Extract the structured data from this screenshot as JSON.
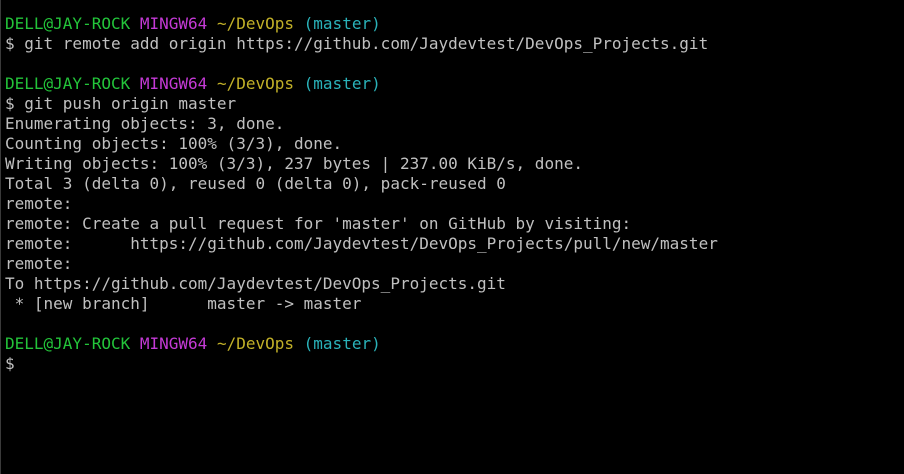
{
  "colors": {
    "background": "#000000",
    "foreground": "#c0c0c0",
    "user_host": "#23c43a",
    "system": "#c43ad6",
    "path": "#c2b128",
    "branch": "#2ab2b9"
  },
  "prompts": [
    {
      "user_host": "DELL@JAY-ROCK",
      "system": "MINGW64",
      "path": "~/DevOps",
      "branch": "(master)",
      "command": "$ git remote add origin https://github.com/Jaydevtest/DevOps_Projects.git"
    },
    {
      "user_host": "DELL@JAY-ROCK",
      "system": "MINGW64",
      "path": "~/DevOps",
      "branch": "(master)",
      "command": "$ git push origin master"
    },
    {
      "user_host": "DELL@JAY-ROCK",
      "system": "MINGW64",
      "path": "~/DevOps",
      "branch": "(master)",
      "command": "$"
    }
  ],
  "push_output": [
    "Enumerating objects: 3, done.",
    "Counting objects: 100% (3/3), done.",
    "Writing objects: 100% (3/3), 237 bytes | 237.00 KiB/s, done.",
    "Total 3 (delta 0), reused 0 (delta 0), pack-reused 0",
    "remote:",
    "remote: Create a pull request for 'master' on GitHub by visiting:",
    "remote:      https://github.com/Jaydevtest/DevOps_Projects/pull/new/master",
    "remote:",
    "To https://github.com/Jaydevtest/DevOps_Projects.git",
    " * [new branch]      master -> master"
  ]
}
